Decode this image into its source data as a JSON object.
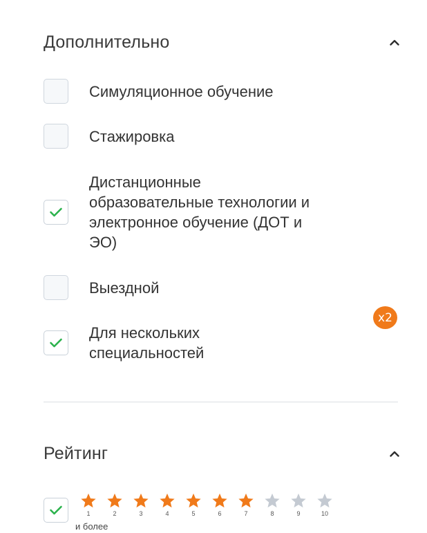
{
  "additional": {
    "title": "Дополнительно",
    "options": [
      {
        "label": "Симуляционное обучение",
        "checked": false
      },
      {
        "label": "Стажировка",
        "checked": false
      },
      {
        "label": "Дистанционные\nобразовательные технологии и\nэлектронное обучение (ДОТ и\nЭО)",
        "checked": true
      },
      {
        "label": "Выездной",
        "checked": false
      },
      {
        "label": "Для нескольких\nспециальностей",
        "checked": true
      }
    ],
    "badge": "x2"
  },
  "rating": {
    "title": "Рейтинг",
    "checked": true,
    "stars": [
      {
        "num": "1",
        "filled": true
      },
      {
        "num": "2",
        "filled": true
      },
      {
        "num": "3",
        "filled": true
      },
      {
        "num": "4",
        "filled": true
      },
      {
        "num": "5",
        "filled": true
      },
      {
        "num": "6",
        "filled": true
      },
      {
        "num": "7",
        "filled": true
      },
      {
        "num": "8",
        "filled": false
      },
      {
        "num": "9",
        "filled": false
      },
      {
        "num": "10",
        "filled": false
      }
    ],
    "and_more": "и более",
    "selected_value": 7
  },
  "colors": {
    "accent_orange": "#f07a1a",
    "check_green": "#2bb24c",
    "star_empty": "#c4cad2"
  },
  "icons": {
    "collapse": "chevron-up-icon",
    "check": "checkmark-icon",
    "star": "star-icon"
  }
}
